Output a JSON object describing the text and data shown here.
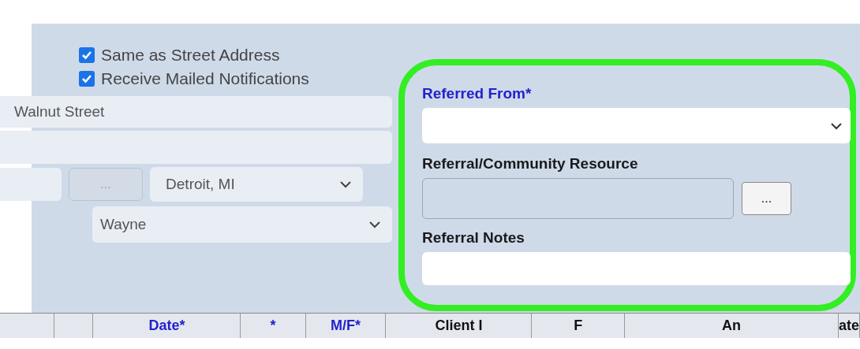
{
  "mailing": {
    "checkboxes": [
      {
        "label": "Same as Street Address",
        "checked": true
      },
      {
        "label": "Receive Mailed Notifications",
        "checked": true
      }
    ],
    "street": "Walnut Street",
    "city_button": {
      "label": "...",
      "disabled": true
    },
    "city": "Detroit, MI",
    "county": "Wayne"
  },
  "referral": {
    "referred_from": {
      "label": "Referred From*",
      "required": true
    },
    "resource": {
      "label": "Referral/Community Resource",
      "required": false,
      "button": {
        "label": "...",
        "disabled": false
      }
    },
    "notes": {
      "label": "Referral Notes",
      "required": false
    }
  },
  "table": {
    "columns": [
      {},
      {},
      {
        "label": "Date*",
        "required": true
      },
      {
        "label": "*",
        "required": true
      },
      {
        "label": "M/F*",
        "required": true
      },
      {
        "label": "Client I",
        "required": false
      },
      {
        "label": "F",
        "required": false
      },
      {
        "label": "An",
        "required": false
      },
      {
        "label": "ate",
        "required": false
      }
    ]
  }
}
